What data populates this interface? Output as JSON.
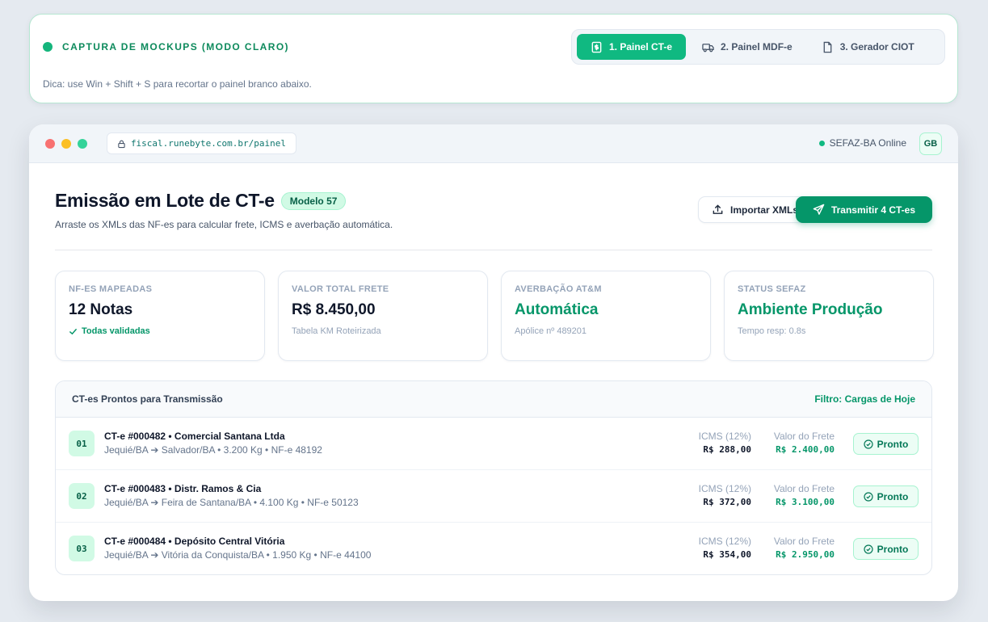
{
  "capture": {
    "title": "CAPTURA DE MOCKUPS (MODO CLARO)",
    "tip": "Dica: use Win + Shift + S para recortar o painel branco abaixo.",
    "tabs": [
      {
        "label": "1. Painel CT-e",
        "icon": "dollar-doc-icon",
        "active": true
      },
      {
        "label": "2. Painel MDF-e",
        "icon": "truck-icon",
        "active": false
      },
      {
        "label": "3. Gerador CIOT",
        "icon": "file-icon",
        "active": false
      }
    ]
  },
  "window": {
    "url": "fiscal.runebyte.com.br/painel",
    "status": "SEFAZ-BA Online",
    "avatar": "GB"
  },
  "header": {
    "title": "Emissão em Lote de CT-e",
    "badge": "Modelo 57",
    "subtitle": "Arraste os XMLs das NF-es para calcular frete, ICMS e averbação automática.",
    "import_label": "Importar XMLs",
    "transmit_label": "Transmitir 4 CT-es"
  },
  "stats": [
    {
      "label": "NF-ES MAPEADAS",
      "value": "12 Notas",
      "note": "Todas validadas"
    },
    {
      "label": "VALOR TOTAL FRETE",
      "value": "R$ 8.450,00",
      "note": "Tabela KM Roteirizada"
    },
    {
      "label": "AVERBAÇÃO AT&M",
      "value": "Automática",
      "note": "Apólice nº 489201"
    },
    {
      "label": "STATUS SEFAZ",
      "value": "Ambiente Produção",
      "note": "Tempo resp: 0.8s"
    }
  ],
  "table": {
    "title": "CT-es Prontos para Transmissão",
    "filter": "Filtro: Cargas de Hoje",
    "icms_label": "ICMS (12%)",
    "frete_label": "Valor do Frete",
    "status_label": "Pronto",
    "rows": [
      {
        "num": "01",
        "title": "CT-e #000482 • Comercial Santana Ltda",
        "sub": "Jequié/BA ➔ Salvador/BA • 3.200 Kg • NF-e 48192",
        "icms": "R$ 288,00",
        "frete": "R$ 2.400,00"
      },
      {
        "num": "02",
        "title": "CT-e #000483 • Distr. Ramos & Cia",
        "sub": "Jequié/BA ➔ Feira de Santana/BA • 4.100 Kg • NF-e 50123",
        "icms": "R$ 372,00",
        "frete": "R$ 3.100,00"
      },
      {
        "num": "03",
        "title": "CT-e #000484 • Depósito Central Vitória",
        "sub": "Jequié/BA ➔ Vitória da Conquista/BA • 1.950 Kg • NF-e 44100",
        "icms": "R$ 354,00",
        "frete": "R$ 2.950,00"
      }
    ]
  },
  "colors": {
    "accent": "#10b981",
    "accent_dark": "#059669",
    "traffic_red": "#f87171",
    "traffic_yellow": "#fbbf24",
    "traffic_green": "#34d399"
  }
}
